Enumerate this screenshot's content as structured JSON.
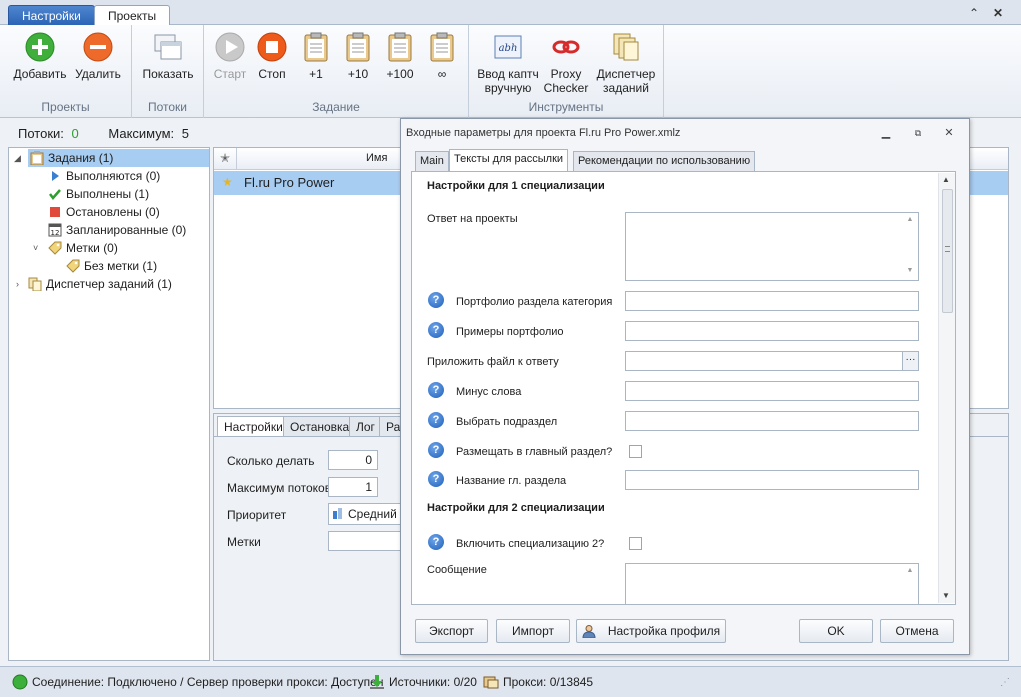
{
  "top_tabs": {
    "settings": "Настройки",
    "projects": "Проекты"
  },
  "ribbon": {
    "groups": {
      "projects": {
        "label": "Проекты",
        "add": "Добавить",
        "delete": "Удалить"
      },
      "streams": {
        "label": "Потоки",
        "show": "Показать"
      },
      "task": {
        "label": "Задание",
        "start": "Старт",
        "stop": "Стоп",
        "plus1": "+1",
        "plus10": "+10",
        "plus100": "+100",
        "infinity": "∞"
      },
      "tools": {
        "label": "Инструменты",
        "captcha_1": "Ввод каптч",
        "captcha_2": "вручную",
        "proxy_1": "Proxy",
        "proxy_2": "Checker",
        "dispatcher_1": "Диспетчер",
        "dispatcher_2": "заданий"
      }
    }
  },
  "streams_bar": {
    "threads_label": "Потоки:",
    "threads_value": "0",
    "max_label": "Максимум:",
    "max_value": "5"
  },
  "tree": {
    "tasks": "Задания (1)",
    "running": "Выполняются (0)",
    "done": "Выполнены (1)",
    "stopped": "Остановлены (0)",
    "scheduled": "Запланированные (0)",
    "tags": "Метки (0)",
    "no_tags": "Без метки (1)",
    "dispatcher": "Диспетчер заданий (1)"
  },
  "list": {
    "col_name": "Имя",
    "row_name": "Fl.ru Pro Power"
  },
  "bottom": {
    "tabs": [
      "Настройки",
      "Остановка",
      "Лог",
      "Рас"
    ],
    "how_many_label": "Сколько делать",
    "how_many_value": "0",
    "max_threads_label": "Максимум потоков",
    "max_threads_value": "1",
    "priority_label": "Приоритет",
    "priority_value": "Средний",
    "tags_label": "Метки"
  },
  "dialog": {
    "title": "Входные параметры для проекта Fl.ru Pro Power.xmlz",
    "tabs": [
      "Main",
      "Тексты для рассылки",
      "Рекомендации по использованию"
    ],
    "section1": "Настройки для 1 специализации",
    "reply": "Ответ на проекты",
    "portfolio_cat": "Портфолио раздела категория",
    "portfolio_examples": "Примеры портфолио",
    "attach": "Приложить файл к ответу",
    "minus_words": "Минус слова",
    "choose_sub": "Выбрать подраздел",
    "place_main": "Размещать в главный раздел?",
    "main_name": "Название гл. раздела",
    "section2": "Настройки для 2 специализации",
    "enable_spec2": "Включить специализацию 2?",
    "message": "Сообщение",
    "browse": "···",
    "buttons": {
      "export": "Экспорт",
      "import": "Импорт",
      "profile": "Настройка профиля",
      "ok": "OK",
      "cancel": "Отмена"
    }
  },
  "status": {
    "connection": "Соединение: Подключено / Сервер проверки прокси: Доступен",
    "sources": "Источники: 0/20",
    "proxy": "Прокси: 0/13845"
  },
  "colors": {
    "accent": "#2a63b5",
    "selection": "#a8cdf2",
    "green": "#2e9e2e",
    "red": "#e04a1a"
  }
}
